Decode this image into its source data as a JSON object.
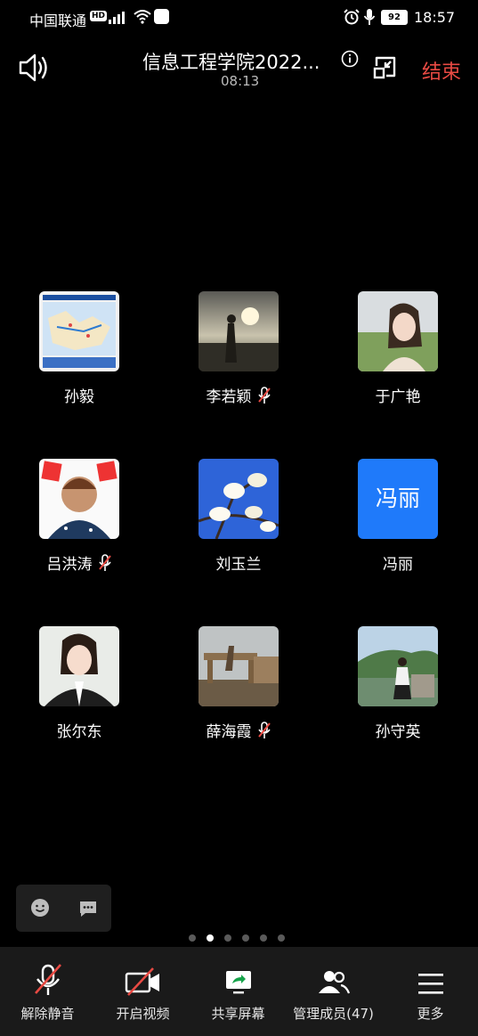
{
  "status_bar": {
    "carrier": "中国联通",
    "hd": "HD",
    "network": "4G",
    "battery": "92",
    "time": "18:57"
  },
  "header": {
    "title": "信息工程学院2022...",
    "duration": "08:13",
    "end_label": "结束"
  },
  "participants": [
    {
      "name": "孙毅",
      "muted": false
    },
    {
      "name": "李若颖",
      "muted": true
    },
    {
      "name": "于广艳",
      "muted": false
    },
    {
      "name": "吕洪涛",
      "muted": true
    },
    {
      "name": "刘玉兰",
      "muted": false
    },
    {
      "name": "冯丽",
      "muted": false,
      "avatar_text": "冯丽"
    },
    {
      "name": "张尔东",
      "muted": false
    },
    {
      "name": "薛海霞",
      "muted": true
    },
    {
      "name": "孙守英",
      "muted": false
    }
  ],
  "pager": {
    "total": 6,
    "active": 2
  },
  "toolbar": {
    "unmute": "解除静音",
    "start_video": "开启视频",
    "share_screen": "共享屏幕",
    "manage_members": "管理成员(47)",
    "more": "更多"
  },
  "colors": {
    "accent_blue": "#1f7afa",
    "end_red": "#e84a43",
    "mute_red": "#e84a43"
  }
}
